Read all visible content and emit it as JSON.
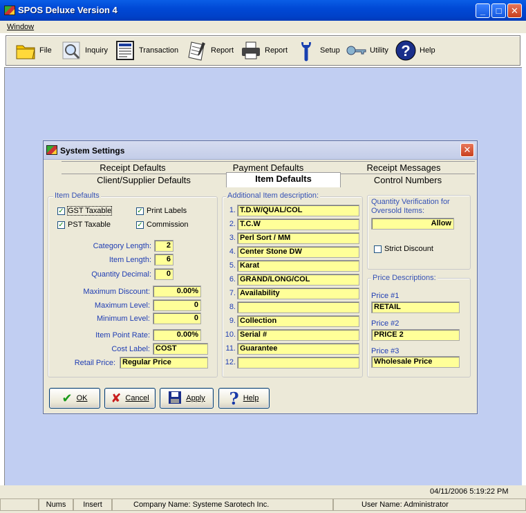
{
  "window": {
    "title": "SPOS Deluxe Version 4",
    "minimize": "_",
    "maximize": "□",
    "close": "✕"
  },
  "menu": {
    "window": "Window"
  },
  "toolbar": [
    {
      "label": "File",
      "icon": "folder-icon"
    },
    {
      "label": "Inquiry",
      "icon": "magnifier-icon"
    },
    {
      "label": "Transaction",
      "icon": "document-icon"
    },
    {
      "label": "Report",
      "icon": "notepad-icon"
    },
    {
      "label": "Report",
      "icon": "printer-icon"
    },
    {
      "label": "Setup",
      "icon": "wrench-icon"
    },
    {
      "label": "Utility",
      "icon": "key-icon"
    },
    {
      "label": "Help",
      "icon": "help-icon"
    }
  ],
  "dialog": {
    "title": "System Settings",
    "tabs_back": [
      "Receipt Defaults",
      "Payment Defaults",
      "Receipt Messages"
    ],
    "tabs_front": [
      "Client/Supplier Defaults",
      "Item Defaults",
      "Control Numbers"
    ],
    "active_tab": "Item Defaults",
    "item_defaults": {
      "legend": "Item Defaults",
      "checkboxes": [
        {
          "label": "GST Taxable",
          "checked": true
        },
        {
          "label": "Print Labels",
          "checked": true
        },
        {
          "label": "PST Taxable",
          "checked": true
        },
        {
          "label": "Commission",
          "checked": true
        }
      ],
      "category_length_label": "Category Length:",
      "category_length": "2",
      "item_length_label": "Item Length:",
      "item_length": "6",
      "quantity_decimal_label": "Quantity Decimal:",
      "quantity_decimal": "0",
      "maximum_discount_label": "Maximum Discount:",
      "maximum_discount": "0.00%",
      "maximum_level_label": "Maximum Level:",
      "maximum_level": "0",
      "minimum_level_label": "Minimum Level:",
      "minimum_level": "0",
      "item_point_rate_label": "Item Point Rate:",
      "item_point_rate": "0.00%",
      "cost_label_label": "Cost Label:",
      "cost_label": "COST",
      "retail_price_label": "Retail Price:",
      "retail_price": "Regular Price"
    },
    "additional": {
      "legend": "Additional Item description:",
      "items": [
        {
          "n": "1.",
          "v": "T.D.W/QUAL/COL"
        },
        {
          "n": "2.",
          "v": "T.C.W"
        },
        {
          "n": "3.",
          "v": "Perl Sort / MM"
        },
        {
          "n": "4.",
          "v": "Center Stone DW"
        },
        {
          "n": "5.",
          "v": "Karat"
        },
        {
          "n": "6.",
          "v": "GRAND/LONG/COL"
        },
        {
          "n": "7.",
          "v": "Availability"
        },
        {
          "n": "8.",
          "v": ""
        },
        {
          "n": "9.",
          "v": "Collection"
        },
        {
          "n": "10.",
          "v": "Serial #"
        },
        {
          "n": "11.",
          "v": "Guarantee"
        },
        {
          "n": "12.",
          "v": ""
        }
      ]
    },
    "quantity_verification": {
      "legend": "Quantity Verification for Oversold Items:",
      "value": "Allow",
      "strict_discount": "Strict Discount",
      "strict_checked": false
    },
    "price_descriptions": {
      "legend": "Price Descriptions:",
      "items": [
        {
          "label": "Price #1",
          "value": "RETAIL"
        },
        {
          "label": "Price #2",
          "value": "PRICE 2"
        },
        {
          "label": "Price #3",
          "value": "Wholesale Price"
        }
      ]
    },
    "buttons": {
      "ok": "OK",
      "cancel": "Cancel",
      "apply": "Apply",
      "help": "Help"
    }
  },
  "status": {
    "datetime": "04/11/2006  5:19:22 PM",
    "nums": "Nums",
    "insert": "Insert",
    "company": "Company Name: Systeme Sarotech Inc.",
    "user": "User Name: Administrator"
  }
}
